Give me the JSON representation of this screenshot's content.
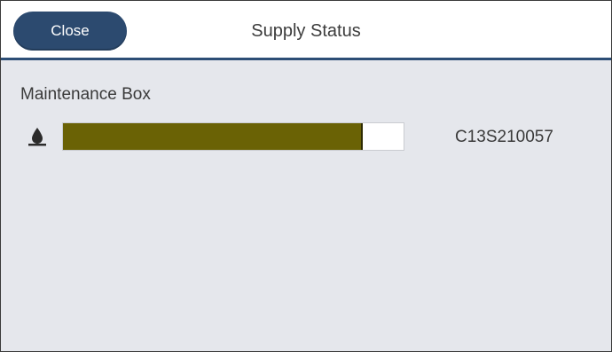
{
  "header": {
    "close_label": "Close",
    "title": "Supply Status"
  },
  "supply": {
    "name": "Maintenance Box",
    "icon": "ink-drop-icon",
    "level_fraction": 0.88,
    "part_number": "C13S210057"
  },
  "colors": {
    "header_accent": "#2d4e76",
    "button_bg": "#2c4a6f",
    "level_fill": "#6a6205",
    "panel_bg": "#e5e7ec"
  }
}
